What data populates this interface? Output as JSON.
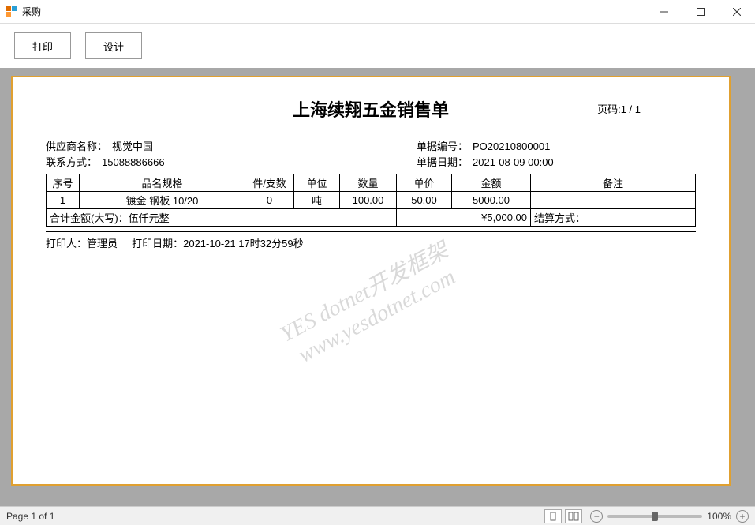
{
  "window": {
    "title": "采购"
  },
  "toolbar": {
    "print_label": "打印",
    "design_label": "设计"
  },
  "document": {
    "title": "上海续翔五金销售单",
    "page_label": "页码:",
    "page_value": "1 / 1",
    "supplier_label": "供应商名称：",
    "supplier_value": "视觉中国",
    "order_no_label": "单据编号：",
    "order_no_value": "PO20210800001",
    "contact_label": "联系方式：",
    "contact_value": "15088886666",
    "order_date_label": "单据日期：",
    "order_date_value": "2021-08-09 00:00",
    "columns": {
      "seq": "序号",
      "name": "品名规格",
      "pcs": "件/支数",
      "unit": "单位",
      "qty": "数量",
      "price": "单价",
      "amount": "金额",
      "remark": "备注"
    },
    "rows": [
      {
        "seq": "1",
        "name": "镀金 钢板 10/20",
        "pcs": "0",
        "unit": "吨",
        "qty": "100.00",
        "price": "50.00",
        "amount": "5000.00",
        "remark": ""
      }
    ],
    "total_label_prefix": "合计金额(大写)：",
    "total_cn": "伍仟元整",
    "total_amount": "¥5,000.00",
    "settle_label": "结算方式：",
    "settle_value": "",
    "printer_label": "打印人：",
    "printer_value": "管理员",
    "print_date_label": "打印日期：",
    "print_date_value": "2021-10-21 17时32分59秒",
    "watermark_line1": "YES dotnet开发框架",
    "watermark_line2": "www.yesdotnet.com"
  },
  "statusbar": {
    "page_text": "Page 1 of 1",
    "zoom_text": "100%"
  }
}
